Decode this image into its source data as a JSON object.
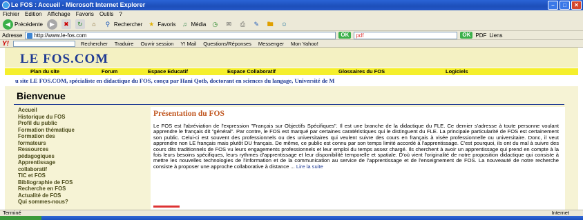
{
  "window": {
    "title": "Le FOS : Accueil - Microsoft Internet Explorer",
    "minimize": "–",
    "maximize": "□",
    "close": "✕"
  },
  "menubar": [
    "Fichier",
    "Edition",
    "Affichage",
    "Favoris",
    "Outils",
    "?"
  ],
  "toolbar": {
    "back": "Précédente",
    "search": "Rechercher",
    "favorites": "Favoris",
    "media": "Média"
  },
  "address": {
    "label": "Adresse",
    "value": "http://www.le-fos.com",
    "ok": "OK",
    "pdf_placeholder": "pdf",
    "pdf_label": "PDF",
    "links": "Liens"
  },
  "yahoo": {
    "logo": "Y!",
    "search": "Rechercher",
    "translate": "Traduire",
    "session": "Ouvrir session",
    "mail": "Y! Mail",
    "qa": "Questions/Réponses",
    "messenger": "Messenger",
    "my": "Mon Yahoo!"
  },
  "site": {
    "logo": "LE FOS.COM",
    "nav": [
      "Plan du site",
      "Forum",
      "Espace Educatif",
      "Espace Collaboratif",
      "Glossaires du FOS",
      "Logiciels"
    ],
    "marquee": "u site LE FOS.COM, spécialiste en didactique du FOS, conçu par Hani Qotb, doctorant en sciences du langage, Université de M",
    "welcome": "Bienvenue",
    "sidebar": [
      "Accueil",
      "Historique du FOS",
      "Profil du public",
      "Formation thématique",
      "Formation des",
      "formateurs",
      "Ressources",
      "pédagogiques",
      "Apprentissage",
      "collaboratif",
      "TIC et FOS",
      "Bibliographie de FOS",
      "Recherche en FOS",
      "Actualité de FOS",
      "Qui sommes-nous?"
    ],
    "main_title": "Présentation du FOS",
    "main_text": "Le FOS est l'abréviation de l'expression \"Français sur Objectifs Spécifiques\". Il est une branche de la didactique du FLE. Ce dernier s'adresse à toute personne voulant apprendre le français dit \"général\". Par contre, le FOS est marqué par certaines caratéristiques qui le distinguent du FLE. La principale particularité de FOS est certainement son public. Celui-ci est souvent des professionnels ou des universitaires qui veulent suivre des cours en français à visée professionnelle ou universitaire. Donc, il veut apprendre non LE français mais plutôt DU français. De même, ce public est connu par son temps limité accordé à l'apprentissage. C'est pourquoi, ils ont du mal à suivre des cours dits traditionnels de FOS vu leurs engagements professionnels et leur emploi du temps assez chargé. Ils cherchent à avoir un apprentissage qui prend en compte à la fois leurs besoins spécifiques, leurs rythmes d'apprentissage et leur disponibilité temporelle et spatiale. D'où vient l'originalité de notre proposition didactique qui consiste à mettre les nouvelles technologies de l'information et de la communication au service de l'apprentissage et de l'enseignement de FOS. La nouveauté de notre recherche consiste à proposer une approche collaborative à distance ...",
    "read_more": "Lire la suite"
  },
  "status": {
    "left": "Terminé",
    "right": "Internet"
  }
}
